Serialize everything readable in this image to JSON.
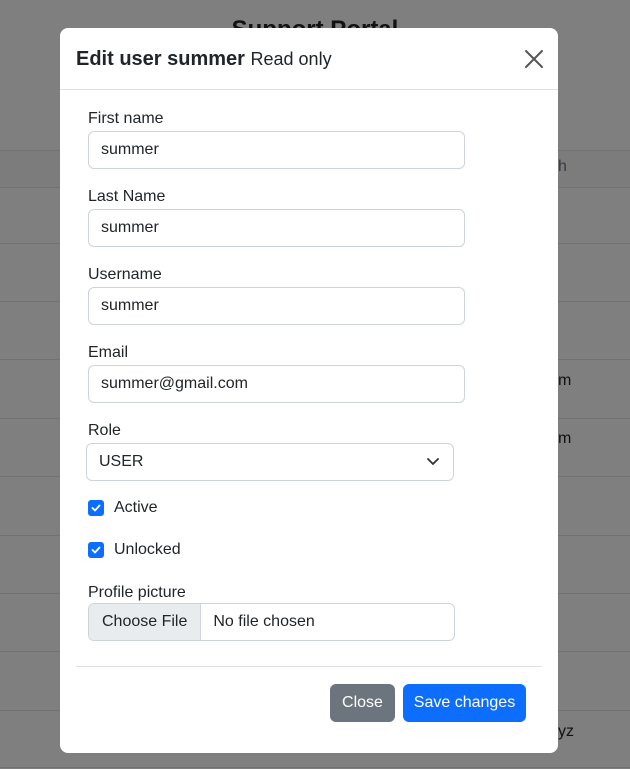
{
  "modal": {
    "title": "Edit user summer",
    "subtitle": "Read only",
    "close_icon": "close-icon"
  },
  "form": {
    "first_name": {
      "label": "First name",
      "value": "summer"
    },
    "last_name": {
      "label": "Last Name",
      "value": "summer"
    },
    "username": {
      "label": "Username",
      "value": "summer"
    },
    "email": {
      "label": "Email",
      "value": "summer@gmail.com"
    },
    "role": {
      "label": "Role",
      "value": "USER"
    },
    "active": {
      "label": "Active",
      "checked": true
    },
    "unlocked": {
      "label": "Unlocked",
      "checked": true
    },
    "profile_picture": {
      "label": "Profile picture",
      "button": "Choose File",
      "status": "No file chosen"
    }
  },
  "footer": {
    "close_label": "Close",
    "save_label": "Save changes"
  },
  "background": {
    "title": "Support Portal",
    "header_tail": "h",
    "row_tails": [
      "m",
      "m",
      "yz"
    ]
  },
  "colors": {
    "primary": "#0d6efd",
    "secondary": "#6c757d",
    "backdrop": "rgba(0,0,0,0.5)"
  }
}
